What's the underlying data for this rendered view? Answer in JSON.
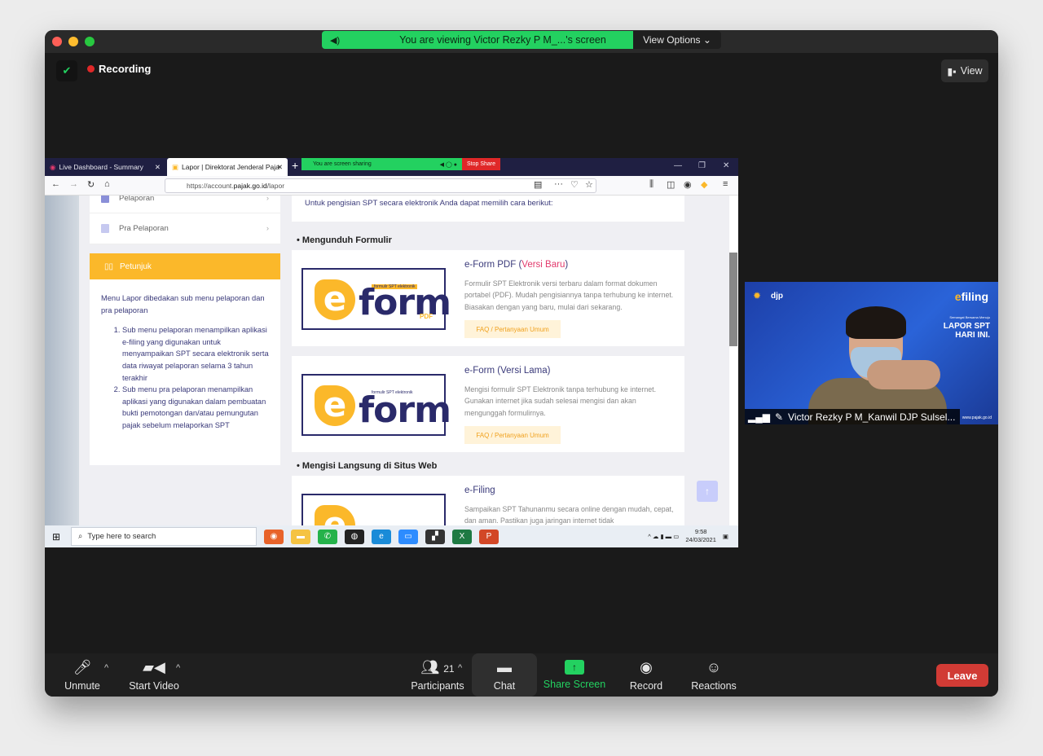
{
  "zoom": {
    "viewing_banner": "You are viewing Victor Rezky P M_...'s screen",
    "view_options": "View Options ⌄",
    "recording": "Recording",
    "view_button": "View"
  },
  "browser": {
    "tab1": "Live Dashboard - Summary",
    "tab2": "Lapor | Direktorat Jenderal Paja",
    "sharing_text": "You are screen sharing",
    "stop_share": "Stop Share",
    "url_prefix": "https://account.",
    "url_domain": "pajak.go.id",
    "url_path": "/lapor"
  },
  "sidebar": {
    "items": [
      {
        "label": "Pelaporan"
      },
      {
        "label": "Pra Pelaporan"
      }
    ],
    "petunjuk_title": "Petunjuk",
    "petunjuk_intro": "Menu Lapor dibedakan sub menu pelaporan dan pra pelaporan",
    "points": [
      "Sub menu pelaporan menampilkan aplikasi e-filing yang digunakan untuk menyampaikan SPT secara elektronik serta data riwayat pelaporan selama 3 tahun terakhir",
      "Sub menu pra pelaporan menampilkan aplikasi yang digunakan dalam pembuatan bukti pemotongan dan/atau pemungutan pajak sebelum melaporkan SPT"
    ]
  },
  "content": {
    "intro": "Untuk pengisian SPT secara elektronik Anda dapat memilih cara berikut:",
    "section1": "• Mengunduh Formulir",
    "section2": "• Mengisi Langsung di Situs Web",
    "cards": [
      {
        "title_main": "e-Form PDF (",
        "title_hl": "Versi Baru",
        "title_end": ")",
        "desc": "Formulir SPT Elektronik versi terbaru dalam format dokumen portabel (PDF). Mudah pengisiannya tanpa terhubung ke internet. Biasakan dengan yang baru, mulai dari sekarang.",
        "faq": "FAQ / Pertanyaan Umum",
        "logo_tag": "formulir SPT elektronik",
        "logo_word": "form",
        "logo_sub": "PDF"
      },
      {
        "title": "e-Form (Versi Lama)",
        "desc": "Mengisi formulir SPT Elektronik tanpa terhubung ke internet. Gunakan internet jika sudah selesai mengisi dan akan mengunggah formulirnya.",
        "faq": "FAQ / Pertanyaan Umum",
        "logo_tag": "formulir SPT elektronik",
        "logo_word": "form"
      },
      {
        "title": "e-Filing",
        "desc": "Sampaikan SPT Tahunanmu secara online dengan mudah, cepat, dan aman. Pastikan juga jaringan internet tidak"
      }
    ]
  },
  "taskbar": {
    "search_placeholder": "Type here to search",
    "time": "9:58",
    "date": "24/03/2021"
  },
  "participant": {
    "name": "Victor Rezky P M_Kanwil DJP Sulsel...",
    "brand_left": "djp",
    "brand_right": "filing",
    "tagline_small": "Semangat Bersama Menuju",
    "tagline": "LAPOR SPT HARI INI.",
    "site": "www.pajak.go.id"
  },
  "toolbar": {
    "unmute": "Unmute",
    "start_video": "Start Video",
    "participants": "Participants",
    "participants_count": "21",
    "chat": "Chat",
    "share_screen": "Share Screen",
    "record": "Record",
    "reactions": "Reactions",
    "leave": "Leave"
  }
}
